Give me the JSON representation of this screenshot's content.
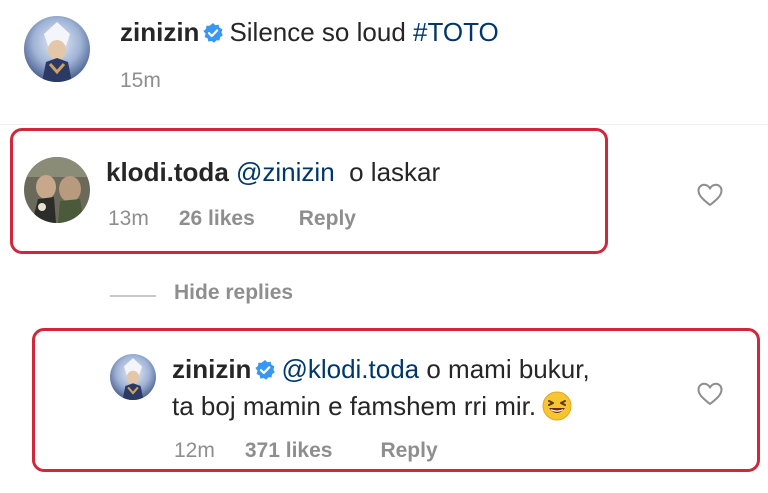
{
  "post": {
    "username": "zinizin",
    "caption": "Silence so loud",
    "hashtag": "#TOTO",
    "time": "15m"
  },
  "comment": {
    "username": "klodi.toda",
    "mention": "@zinizin",
    "text": "o laskar",
    "time": "13m",
    "likes": "26 likes",
    "reply": "Reply"
  },
  "replies_toggle": {
    "label": "Hide replies"
  },
  "reply": {
    "username": "zinizin",
    "mention": "@klodi.toda",
    "text_line1": "o mami bukur,",
    "text_line2": "ta boj mamin e famshem rri mir.",
    "time": "12m",
    "likes": "371 likes",
    "reply": "Reply"
  },
  "colors": {
    "verified_blue": "#3897f0",
    "mention_blue": "#00376b",
    "highlight_red": "#d0283a",
    "meta_gray": "#8e8e8e"
  },
  "icons": [
    "verified-badge-icon",
    "heart-icon",
    "grinning-squinting-face-emoji"
  ]
}
